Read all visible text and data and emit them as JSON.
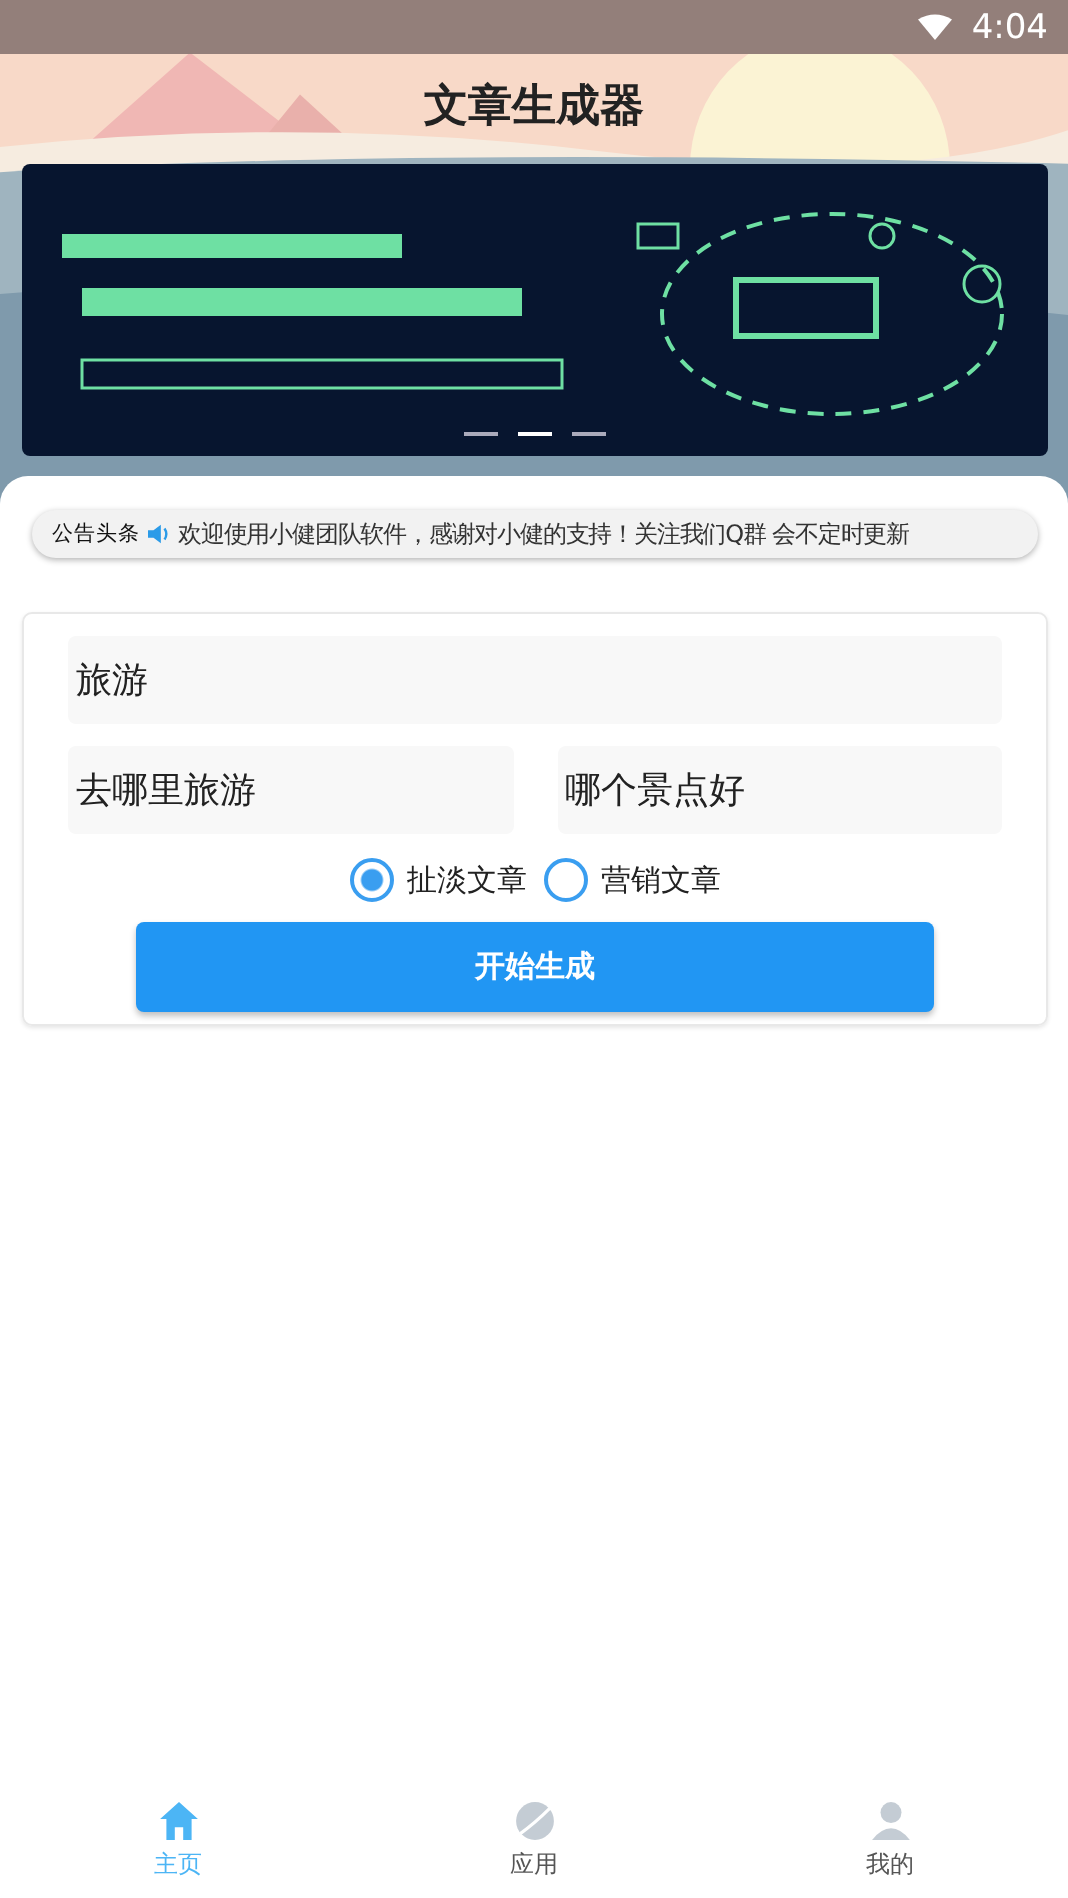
{
  "status_bar": {
    "time": "4:04"
  },
  "header": {
    "title": "文章生成器"
  },
  "banner": {
    "indicators": [
      {
        "selected": false
      },
      {
        "selected": true
      },
      {
        "selected": false
      }
    ]
  },
  "notice": {
    "label": "公告头条",
    "text": "欢迎使用小健团队软件，感谢对小健的支持！关注我们Q群 会不定时更新"
  },
  "form": {
    "topic": {
      "value": "旅游"
    },
    "fields": [
      {
        "value": "去哪里旅游"
      },
      {
        "value": "哪个景点好"
      }
    ],
    "options": [
      {
        "label": "扯淡文章",
        "selected": true
      },
      {
        "label": "营销文章",
        "selected": false
      }
    ],
    "submit": "开始生成"
  },
  "tabs": [
    {
      "label": "主页",
      "kind": "home",
      "selected": true
    },
    {
      "label": "应用",
      "kind": "planet",
      "selected": false
    },
    {
      "label": "我的",
      "kind": "user",
      "selected": false
    }
  ]
}
